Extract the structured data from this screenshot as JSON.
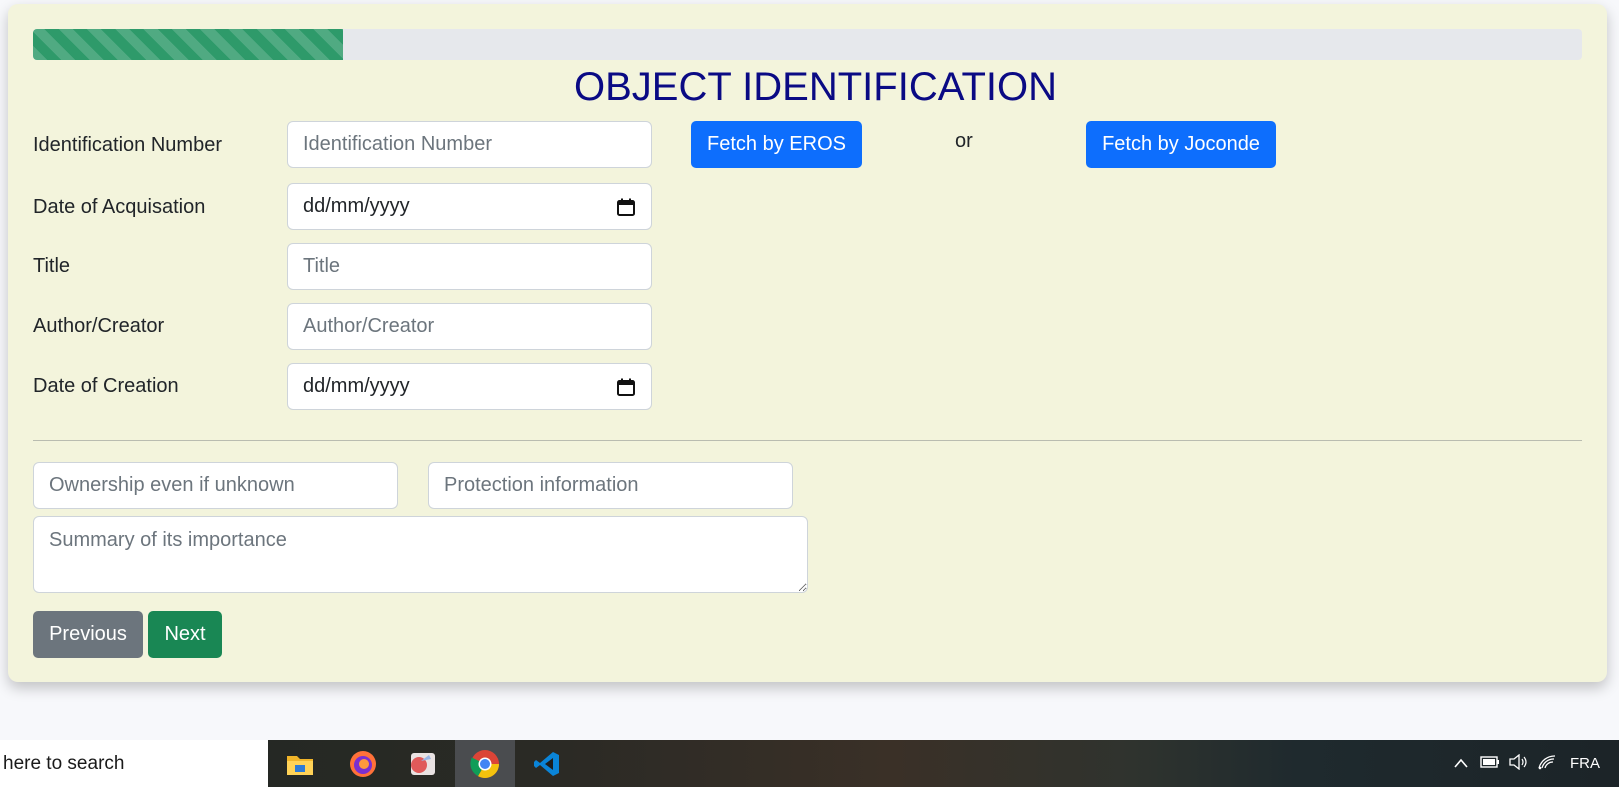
{
  "progress": {
    "value_percent": 20,
    "color": "#2e9a6a"
  },
  "page": {
    "title": "OBJECT IDENTIFICATION"
  },
  "form": {
    "identification_number": {
      "label": "Identification Number",
      "placeholder": "Identification Number"
    },
    "date_of_acquisition": {
      "label": "Date of Acquisation",
      "value": "dd/mm/yyyy"
    },
    "title": {
      "label": "Title",
      "placeholder": "Title"
    },
    "author_creator": {
      "label": "Author/Creator",
      "placeholder": "Author/Creator"
    },
    "date_of_creation": {
      "label": "Date of Creation",
      "value": "dd/mm/yyyy"
    },
    "ownership": {
      "placeholder": "Ownership even if unknown"
    },
    "protection": {
      "placeholder": "Protection information"
    },
    "summary": {
      "placeholder": "Summary of its importance"
    }
  },
  "fetch": {
    "eros_label": "Fetch by EROS",
    "or_text": "or",
    "joconde_label": "Fetch by Joconde"
  },
  "nav": {
    "previous_label": "Previous",
    "next_label": "Next"
  },
  "colors": {
    "primary": "#0d6efd",
    "secondary": "#6c757d",
    "success": "#198754",
    "title": "#0a0a84",
    "card_bg": "#f3f4dc"
  },
  "taskbar": {
    "search_text": "here to search",
    "apps": [
      "file-explorer-icon",
      "firefox-icon",
      "app-icon",
      "chrome-icon",
      "vscode-icon"
    ],
    "language": "FRA"
  }
}
